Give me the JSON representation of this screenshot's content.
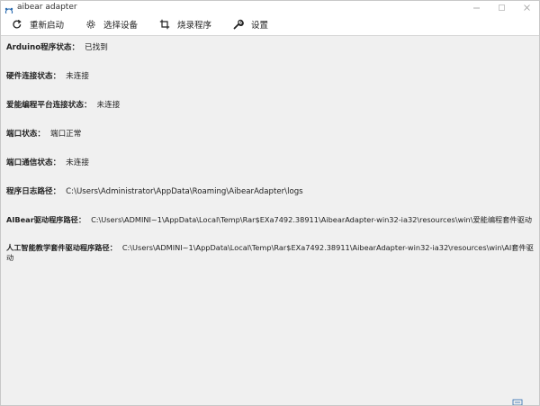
{
  "window": {
    "title": "aibear adapter",
    "accent": "#2b6cb0"
  },
  "toolbar": {
    "items": [
      {
        "icon": "refresh-icon",
        "label": "重新启动"
      },
      {
        "icon": "gear-icon",
        "label": "选择设备"
      },
      {
        "icon": "crop-icon",
        "label": "烧录程序"
      },
      {
        "icon": "wrench-icon",
        "label": "设置"
      }
    ]
  },
  "status": {
    "rows": [
      {
        "label": "Arduino程序状态：",
        "value": "已找到"
      },
      {
        "label": "硬件连接状态：",
        "value": "未连接"
      },
      {
        "label": "爱能编程平台连接状态：",
        "value": "未连接"
      },
      {
        "label": "端口状态：",
        "value": "端口正常"
      },
      {
        "label": "端口通信状态：",
        "value": "未连接"
      },
      {
        "label": "程序日志路径：",
        "value": "C:\\Users\\Administrator\\AppData\\Roaming\\AibearAdapter\\logs"
      },
      {
        "label": "AIBear驱动程序路径：",
        "value": "C:\\Users\\ADMINI~1\\AppData\\Local\\Temp\\Rar$EXa7492.38911\\AibearAdapter-win32-ia32\\resources\\win\\爱能编程套件驱动"
      },
      {
        "label": "人工智能教学套件驱动程序路径：",
        "value": "C:\\Users\\ADMINI~1\\AppData\\Local\\Temp\\Rar$EXa7492.38911\\AibearAdapter-win32-ia32\\resources\\win\\AI套件驱动"
      }
    ]
  }
}
